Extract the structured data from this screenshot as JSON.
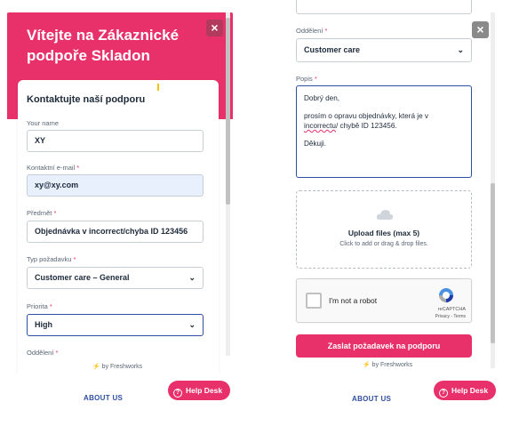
{
  "left": {
    "header_title": "Vítejte na Zákaznické podpoře Skladon",
    "close_glyph": "×",
    "card_heading": "Kontaktujte naší podporu",
    "fields": {
      "name_label": "Your name",
      "name_value": "XY",
      "email_label": "Kontaktní e-mail",
      "email_value": "xy@xy.com",
      "subject_label": "Předmět",
      "subject_value": "Objednávka v incorrect/chyba ID 123456",
      "type_label": "Typ požadavku",
      "type_value": "Customer care – General",
      "priority_label": "Priorita",
      "priority_value": "High",
      "department_label": "Oddělení"
    },
    "required_mark": "*",
    "powered_by": "by Freshworks"
  },
  "right": {
    "close_glyph": "×",
    "department_label": "Oddělení",
    "department_value": "Customer care",
    "description_label": "Popis",
    "description_lines": {
      "l1": "Dobrý den,",
      "l2a": "prosím o opravu objednávky, která je v",
      "l3a": "incorrectu",
      "l3b": "/ chybě ID 123456.",
      "l4": "Děkuji."
    },
    "upload_title": "Upload files (max 5)",
    "upload_sub": "Click to add or drag & drop files.",
    "captcha_label": "I'm not a robot",
    "captcha_brand": "reCAPTCHA",
    "captcha_terms": "Privacy - Terms",
    "submit_label": "Zaslat požadavek na podporu",
    "powered_by": "by Freshworks",
    "required_mark": "*"
  },
  "footer": {
    "about_left": "ABOUT US",
    "about_right": "ABOUT US",
    "help_label": "Help Desk",
    "help_icon_glyph": "?"
  },
  "icons": {
    "chevron": "⌄",
    "bolt": "⚡"
  },
  "colors": {
    "brand_pink": "#e8306a",
    "focus_blue": "#2f4f9e"
  }
}
